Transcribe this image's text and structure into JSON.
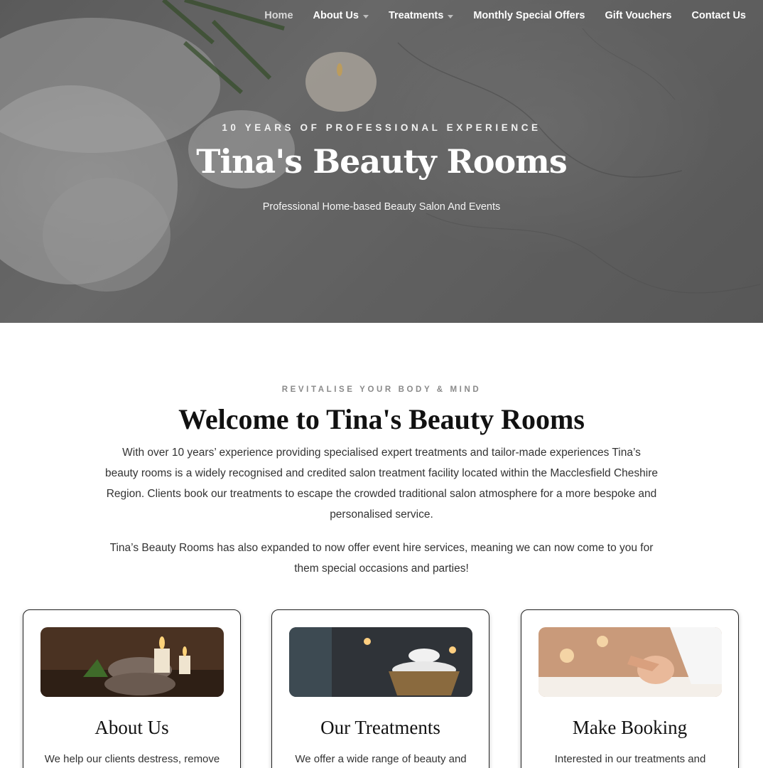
{
  "nav": {
    "items": [
      {
        "label": "Home",
        "has_dropdown": false,
        "active": true
      },
      {
        "label": "About Us",
        "has_dropdown": true,
        "active": false
      },
      {
        "label": "Treatments",
        "has_dropdown": true,
        "active": false
      },
      {
        "label": "Monthly Special Offers",
        "has_dropdown": false,
        "active": false
      },
      {
        "label": "Gift Vouchers",
        "has_dropdown": false,
        "active": false
      },
      {
        "label": "Contact Us",
        "has_dropdown": false,
        "active": false
      }
    ]
  },
  "hero": {
    "kicker": "10 YEARS OF PROFESSIONAL EXPERIENCE",
    "title": "Tina's Beauty Rooms",
    "subtitle": "Professional Home-based Beauty Salon And Events"
  },
  "welcome": {
    "kicker": "REVITALISE YOUR BODY & MIND",
    "title": "Welcome to Tina's Beauty Rooms",
    "paragraph1": "With over 10 years’ experience providing specialised expert treatments and tailor-made experiences Tina’s beauty rooms is a widely recognised and credited salon treatment facility located within the Macclesfield Cheshire Region. Clients book our treatments to escape the crowded traditional salon atmosphere for a more bespoke and personalised service.",
    "paragraph2": "Tina’s Beauty Rooms has also expanded to now offer event hire services, meaning we can now come to you for them special occasions and parties!"
  },
  "cards": [
    {
      "title": "About Us",
      "text": "We help our clients destress, remove"
    },
    {
      "title": "Our Treatments",
      "text": "We offer a wide range of beauty and"
    },
    {
      "title": "Make Booking",
      "text": "Interested in our treatments and"
    }
  ],
  "colors": {
    "nav_text": "#ffffff",
    "nav_active": "#d9d9d9",
    "kicker_gray": "#8a8a8a",
    "heading": "#111111",
    "body_text": "#333333"
  }
}
